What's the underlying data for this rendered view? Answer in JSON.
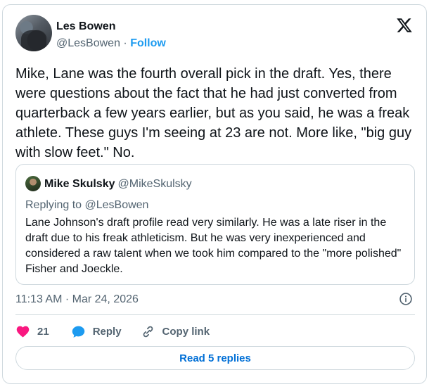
{
  "author": {
    "name": "Les Bowen",
    "handle": "@LesBowen",
    "separator": " · ",
    "follow_label": "Follow"
  },
  "tweet_text": "Mike, Lane was the fourth overall pick in the draft. Yes, there were questions about the fact that he had just converted from quarterback a few years earlier, but as you said, he was a freak athlete. These guys I'm seeing at 23 are not. More like, \"big guy with slow feet.\" No.",
  "quoted": {
    "name": "Mike Skulsky",
    "handle": "@MikeSkulsky",
    "replying_to": "Replying to @LesBowen",
    "text": "Lane Johnson's draft profile read very similarly. He was a late riser in the draft due to his freak athleticism. But he was very inexperienced and considered a raw talent when we took him compared to the \"more polished\" Fisher and Joeckle."
  },
  "timestamp": "11:13 AM · Mar 24, 2026",
  "actions": {
    "like_count": "21",
    "reply_label": "Reply",
    "copy_link_label": "Copy link"
  },
  "read_replies_label": "Read 5 replies",
  "colors": {
    "accent": "#1d9bf0",
    "like": "#f91880",
    "border": "#cfd9de",
    "muted": "#536471"
  },
  "icons": {
    "brand": "x-logo-icon",
    "info": "info-icon",
    "like": "heart-icon",
    "reply": "speech-bubble-icon",
    "copy_link": "link-icon"
  }
}
